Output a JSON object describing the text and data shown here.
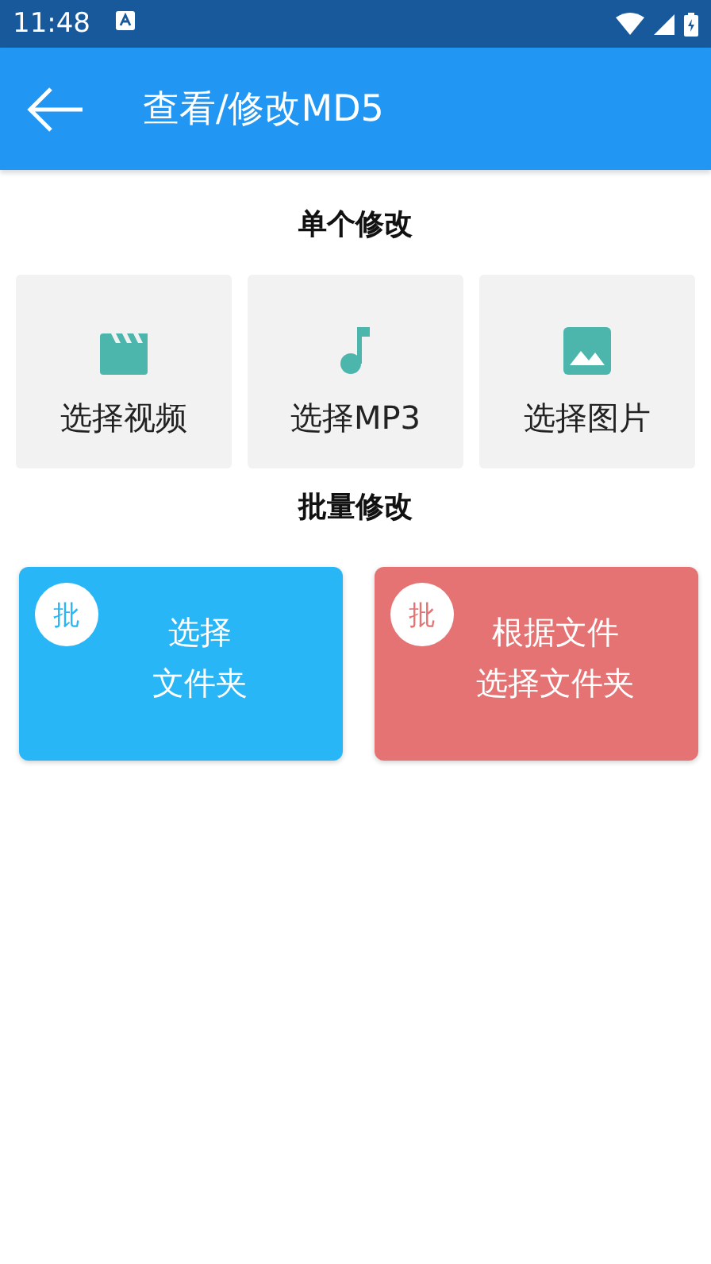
{
  "status_bar": {
    "time": "11:48"
  },
  "app_bar": {
    "title": "查看/修改MD5"
  },
  "single_section": {
    "title": "单个修改",
    "items": [
      {
        "kind": "video",
        "label": "选择视频"
      },
      {
        "kind": "music",
        "label": "选择MP3"
      },
      {
        "kind": "image",
        "label": "选择图片"
      }
    ]
  },
  "batch_section": {
    "title": "批量修改",
    "items": [
      {
        "badge": "批",
        "lines": [
          "选择",
          "文件夹"
        ],
        "color": "#29b6f6"
      },
      {
        "badge": "批",
        "lines": [
          "根据文件",
          "选择文件夹"
        ],
        "color": "#e57373"
      }
    ]
  }
}
